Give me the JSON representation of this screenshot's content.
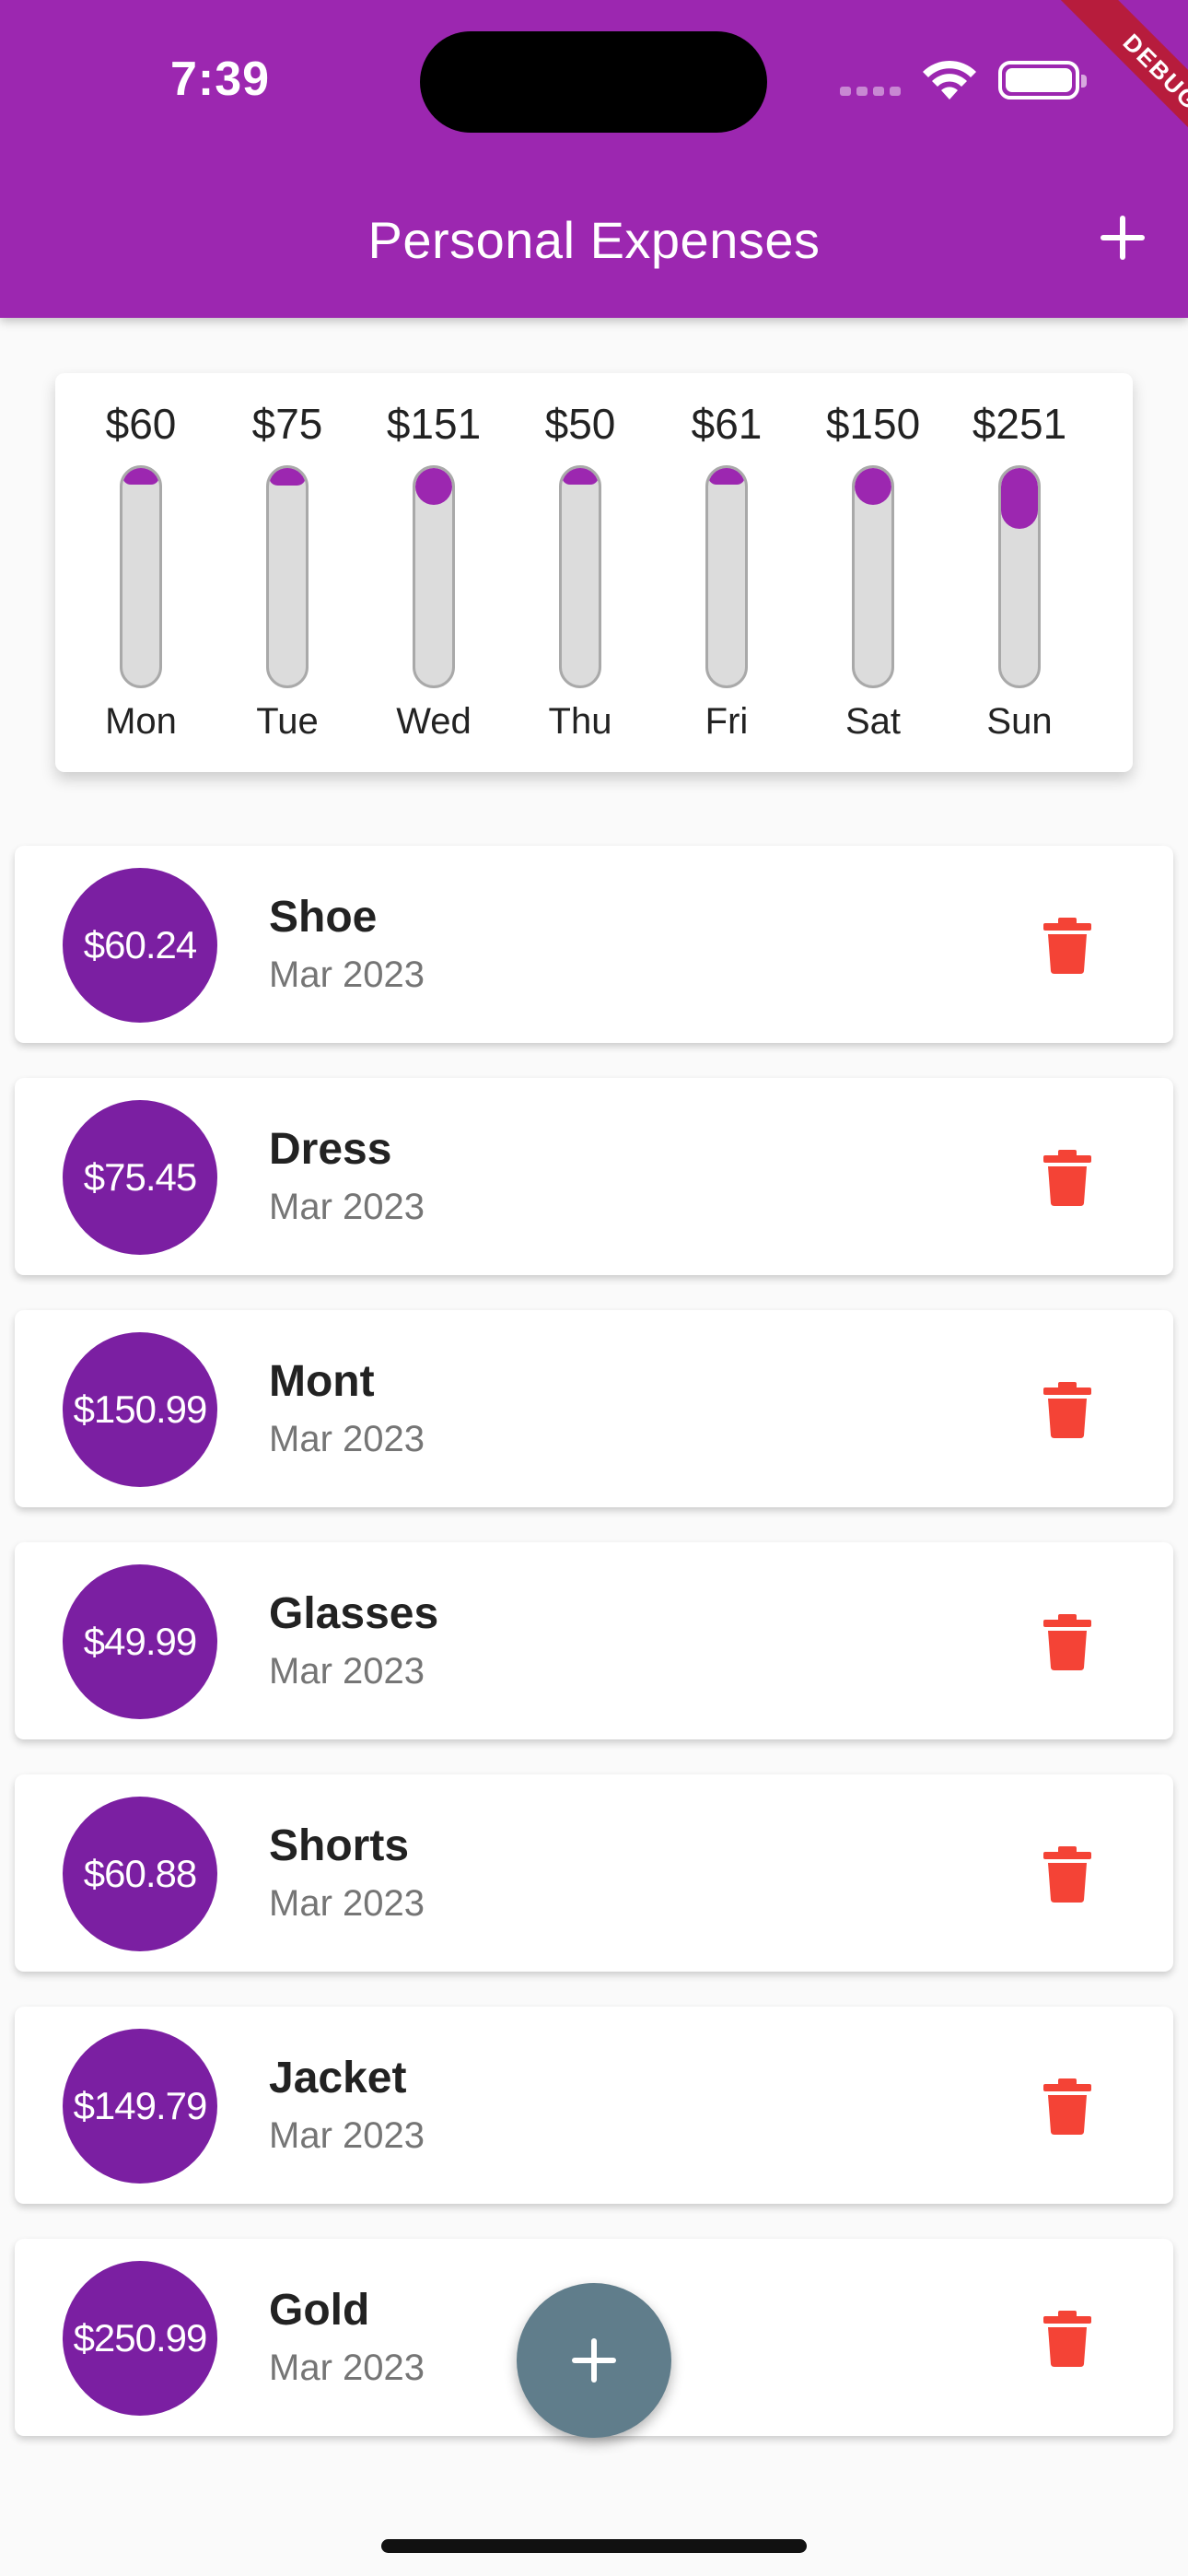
{
  "status_bar": {
    "time": "7:39"
  },
  "debug_banner": "DEBUG",
  "app_bar": {
    "title": "Personal Expenses"
  },
  "colors": {
    "primary": "#9c27b0",
    "avatar": "#7b1fa2",
    "delete": "#f44336",
    "fab": "#607d8b"
  },
  "chart_data": {
    "type": "bar",
    "categories": [
      "Mon",
      "Tue",
      "Wed",
      "Thu",
      "Fri",
      "Sat",
      "Sun"
    ],
    "labels": [
      "$60",
      "$75",
      "$151",
      "$50",
      "$61",
      "$150",
      "$251"
    ],
    "values": [
      60.24,
      75.45,
      150.99,
      49.99,
      60.88,
      149.79,
      250.99
    ],
    "fill_fraction": [
      0.07,
      0.08,
      0.17,
      0.06,
      0.07,
      0.17,
      0.28
    ],
    "grid": false,
    "legend": "none"
  },
  "transactions": [
    {
      "amount": "$60.24",
      "title": "Shoe",
      "date": "Mar 2023"
    },
    {
      "amount": "$75.45",
      "title": "Dress",
      "date": "Mar 2023"
    },
    {
      "amount": "$150.99",
      "title": "Mont",
      "date": "Mar 2023"
    },
    {
      "amount": "$49.99",
      "title": "Glasses",
      "date": "Mar 2023"
    },
    {
      "amount": "$60.88",
      "title": "Shorts",
      "date": "Mar 2023"
    },
    {
      "amount": "$149.79",
      "title": "Jacket",
      "date": "Mar 2023"
    },
    {
      "amount": "$250.99",
      "title": "Gold",
      "date": "Mar 2023"
    }
  ],
  "icons": {
    "appbar_add": "plus-icon",
    "delete": "trash-icon",
    "fab": "plus-icon"
  }
}
